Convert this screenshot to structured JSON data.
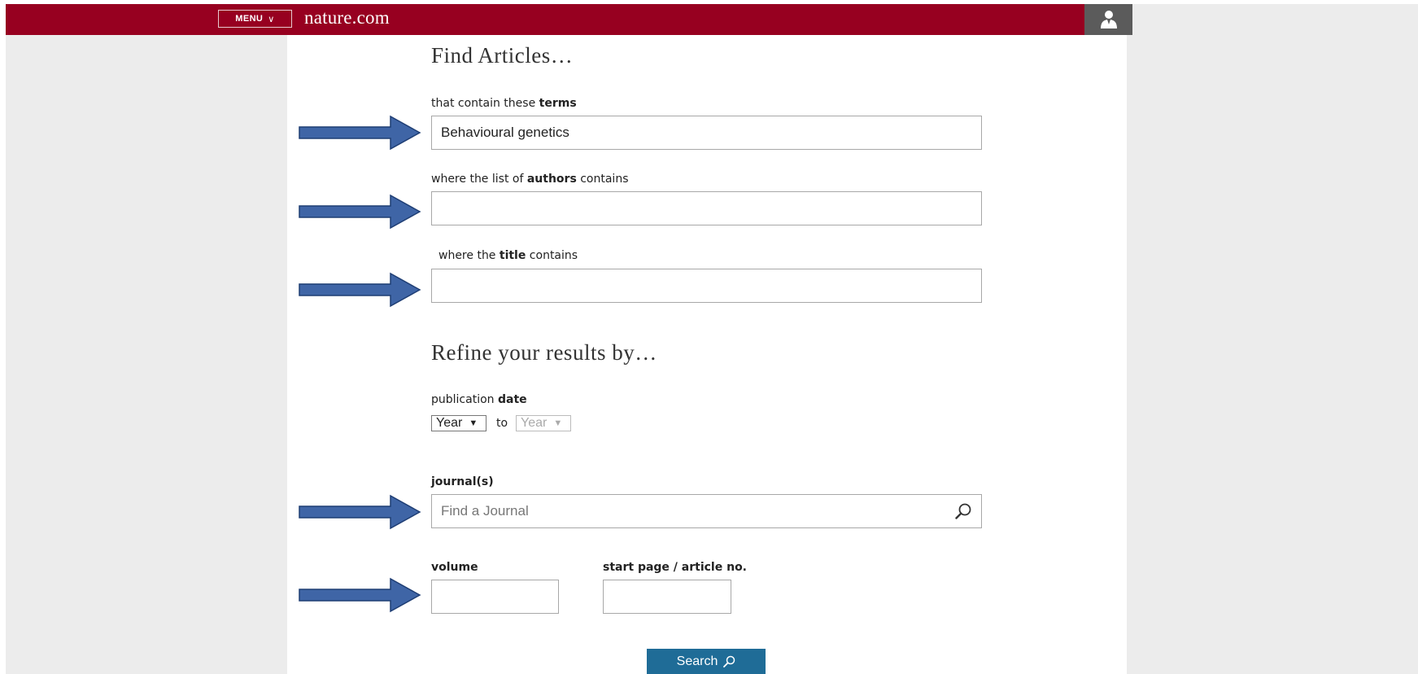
{
  "header": {
    "menu_label": "MENU",
    "brand": "nature.com",
    "user_icon": "user-icon"
  },
  "find": {
    "heading": "Find Articles…",
    "terms_prefix": "that contain these ",
    "terms_bold": "terms",
    "terms_value": "Behavioural genetics",
    "authors_prefix": "where the list of ",
    "authors_bold": "authors",
    "authors_suffix": " contains",
    "authors_value": "",
    "title_prefix": "where the ",
    "title_bold": "title",
    "title_suffix": " contains",
    "title_value": ""
  },
  "refine": {
    "heading": "Refine your results by…",
    "date_prefix": "publication ",
    "date_bold": "date",
    "year_from": "Year",
    "to_text": "to",
    "year_to": "Year",
    "journal_label": "journal(s)",
    "journal_placeholder": "Find a Journal",
    "volume_label": "volume",
    "volume_value": "",
    "startpage_label": "start page / article no.",
    "startpage_value": ""
  },
  "search_button": "Search",
  "colors": {
    "header_bg": "#970020",
    "button_bg": "#1f6c97",
    "arrow_fill": "#3f65a6",
    "arrow_stroke": "#1f3e74"
  }
}
